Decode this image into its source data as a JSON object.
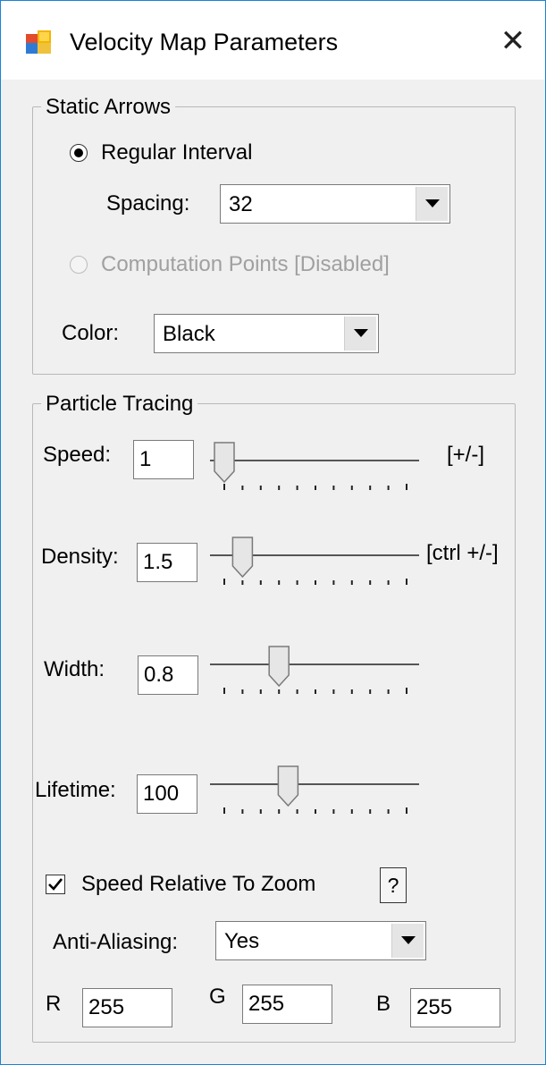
{
  "window": {
    "title": "Velocity Map Parameters",
    "close_glyph": "✕"
  },
  "static_arrows": {
    "legend": "Static Arrows",
    "regular_interval_label": "Regular Interval",
    "regular_interval_selected": true,
    "spacing_label": "Spacing:",
    "spacing_value": "32",
    "computation_points_label": "Computation Points [Disabled]",
    "computation_points_enabled": false,
    "color_label": "Color:",
    "color_value": "Black"
  },
  "particle_tracing": {
    "legend": "Particle Tracing",
    "speed": {
      "label": "Speed:",
      "value": "1",
      "hint": "[+/-]",
      "slider_position": 0.0,
      "slider_ticks": 11
    },
    "density": {
      "label": "Density:",
      "value": "1.5",
      "hint": "[ctrl +/-]",
      "slider_position": 0.1,
      "slider_ticks": 11
    },
    "width": {
      "label": "Width:",
      "value": "0.8",
      "slider_position": 0.3,
      "slider_ticks": 11
    },
    "lifetime": {
      "label": "Lifetime:",
      "value": "100",
      "slider_position": 0.35,
      "slider_ticks": 11
    },
    "speed_relative_label": "Speed Relative To Zoom",
    "speed_relative_checked": true,
    "help_label": "?",
    "anti_aliasing_label": "Anti-Aliasing:",
    "anti_aliasing_value": "Yes",
    "r_label": "R",
    "r_value": "255",
    "g_label": "G",
    "g_value": "255",
    "b_label": "B",
    "b_value": "255"
  }
}
